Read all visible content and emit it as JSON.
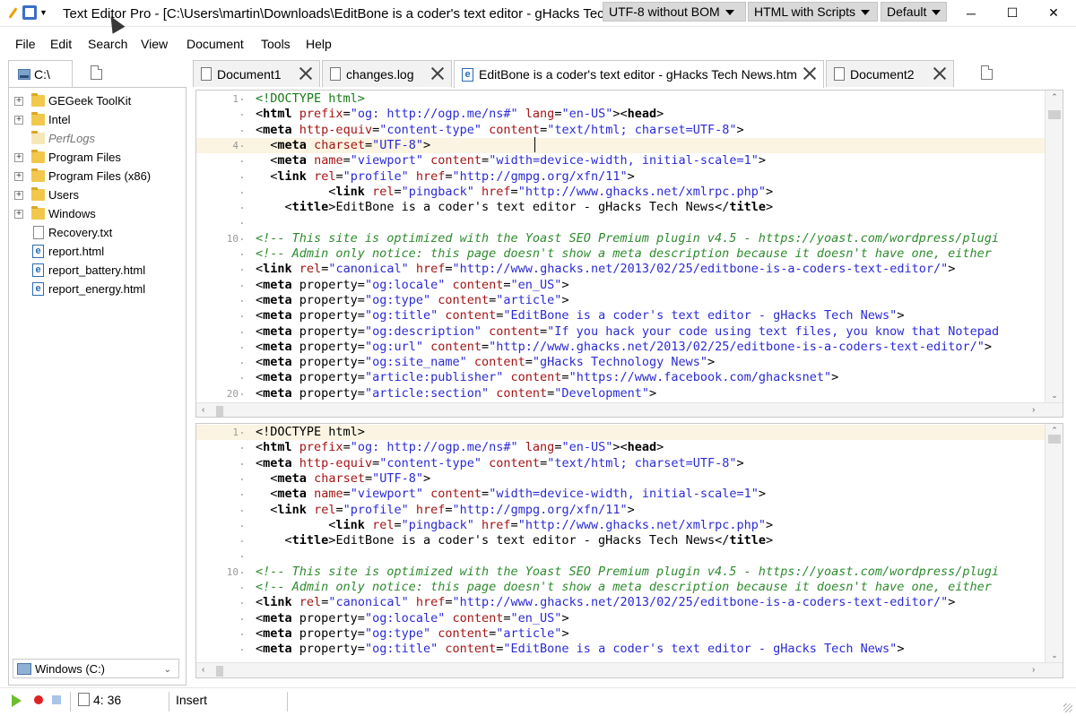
{
  "window": {
    "app_name": "Text Editor Pro",
    "title": "Text Editor Pro  -  [C:\\Users\\martin\\Downloads\\EditBone is a coder's text editor - gHacks Tech News.htm]",
    "encoding": "UTF-8 without BOM",
    "highlighter": "HTML with Scripts",
    "color_scheme": "Default",
    "minimize": "─",
    "maximize": "☐",
    "close": "✕"
  },
  "menu": [
    "File",
    "Edit",
    "Search",
    "View",
    "Document",
    "Tools",
    "Help"
  ],
  "file_panel": {
    "tab_label": "C:\\",
    "tree": [
      {
        "label": "GEGeek ToolKit",
        "type": "folder",
        "expandable": true
      },
      {
        "label": "Intel",
        "type": "folder",
        "expandable": true
      },
      {
        "label": "PerfLogs",
        "type": "folder-hidden",
        "expandable": false
      },
      {
        "label": "Program Files",
        "type": "folder",
        "expandable": true
      },
      {
        "label": "Program Files (x86)",
        "type": "folder",
        "expandable": true
      },
      {
        "label": "Users",
        "type": "folder",
        "expandable": true
      },
      {
        "label": "Windows",
        "type": "folder",
        "expandable": true
      },
      {
        "label": "Recovery.txt",
        "type": "txt",
        "expandable": false
      },
      {
        "label": "report.html",
        "type": "html",
        "expandable": false
      },
      {
        "label": "report_battery.html",
        "type": "html",
        "expandable": false
      },
      {
        "label": "report_energy.html",
        "type": "html",
        "expandable": false
      }
    ],
    "drive_select": "Windows (C:)"
  },
  "tabs": [
    {
      "label": "Document1",
      "active": false
    },
    {
      "label": "changes.log",
      "active": false
    },
    {
      "label": "EditBone is a coder's text editor - gHacks Tech News.htm",
      "active": true
    },
    {
      "label": "Document2",
      "active": false
    }
  ],
  "editor_top": {
    "current_line": 4,
    "lines": [
      {
        "n": "1",
        "html": "<span class='dt'>&lt;!DOCTYPE html&gt;</span>"
      },
      {
        "n": "",
        "html": "<span class='ang'>&lt;</span><span class='tag'>html</span> <span class='attr'>prefix</span>=<span class='val'>\"og: http://ogp.me/ns#\"</span> <span class='attr'>lang</span>=<span class='val'>\"en-US\"</span><span class='ang'>&gt;&lt;</span><span class='tag'>head</span><span class='ang'>&gt;</span>"
      },
      {
        "n": "",
        "html": "<span class='ang'>&lt;</span><span class='tag'>meta</span> <span class='attr'>http-equiv</span>=<span class='val'>\"content-type\"</span> <span class='attr'>content</span>=<span class='val'>\"text/html; charset=UTF-8\"</span><span class='ang'>&gt;</span>"
      },
      {
        "n": "4",
        "html": "  <span class='ang'>&lt;</span><span class='tag'>meta</span> <span class='attr'>charset</span>=<span class='val'>\"UTF-8\"</span><span class='ang'>&gt;</span>"
      },
      {
        "n": "",
        "html": "  <span class='ang'>&lt;</span><span class='tag'>meta</span> <span class='attr'>name</span>=<span class='val'>\"viewport\"</span> <span class='attr'>content</span>=<span class='val'>\"width=device-width, initial-scale=1\"</span><span class='ang'>&gt;</span>"
      },
      {
        "n": "",
        "html": "  <span class='ang'>&lt;</span><span class='tag'>link</span> <span class='attr'>rel</span>=<span class='val'>\"profile\"</span> <span class='attr'>href</span>=<span class='val'>\"http://gmpg.org/xfn/11\"</span><span class='ang'>&gt;</span>"
      },
      {
        "n": "",
        "html": "          <span class='ang'>&lt;</span><span class='tag'>link</span> <span class='attr'>rel</span>=<span class='val'>\"pingback\"</span> <span class='attr'>href</span>=<span class='val'>\"http://www.ghacks.net/xmlrpc.php\"</span><span class='ang'>&gt;</span>"
      },
      {
        "n": "",
        "html": "    <span class='ang'>&lt;</span><span class='tag'>title</span><span class='ang'>&gt;</span>EditBone is a coder's text editor - gHacks Tech News<span class='ang'>&lt;/</span><span class='tag'>title</span><span class='ang'>&gt;</span>"
      },
      {
        "n": "",
        "html": ""
      },
      {
        "n": "10",
        "html": "<span class='cm'>&lt;!-- This site is optimized with the Yoast SEO Premium plugin v4.5 - https://yoast.com/wordpress/plugi</span>"
      },
      {
        "n": "",
        "html": "<span class='cm'>&lt;!-- Admin only notice: this page doesn't show a meta description because it doesn't have one, either</span>"
      },
      {
        "n": "",
        "html": "<span class='ang'>&lt;</span><span class='tag'>link</span> <span class='attr'>rel</span>=<span class='val'>\"canonical\"</span> <span class='attr'>href</span>=<span class='val'>\"http://www.ghacks.net/2013/02/25/editbone-is-a-coders-text-editor/\"</span><span class='ang'>&gt;</span>"
      },
      {
        "n": "",
        "html": "<span class='ang'>&lt;</span><span class='tag'>meta</span> property=<span class='val'>\"og:locale\"</span> <span class='attr'>content</span>=<span class='val'>\"en_US\"</span><span class='ang'>&gt;</span>"
      },
      {
        "n": "",
        "html": "<span class='ang'>&lt;</span><span class='tag'>meta</span> property=<span class='val'>\"og:type\"</span> <span class='attr'>content</span>=<span class='val'>\"article\"</span><span class='ang'>&gt;</span>"
      },
      {
        "n": "",
        "html": "<span class='ang'>&lt;</span><span class='tag'>meta</span> property=<span class='val'>\"og:title\"</span> <span class='attr'>content</span>=<span class='val'>\"EditBone is a coder's text editor - gHacks Tech News\"</span><span class='ang'>&gt;</span>"
      },
      {
        "n": "",
        "html": "<span class='ang'>&lt;</span><span class='tag'>meta</span> property=<span class='val'>\"og:description\"</span> <span class='attr'>content</span>=<span class='val'>\"If you hack your code using text files, you know that Notepad</span>"
      },
      {
        "n": "",
        "html": "<span class='ang'>&lt;</span><span class='tag'>meta</span> property=<span class='val'>\"og:url\"</span> <span class='attr'>content</span>=<span class='val'>\"http://www.ghacks.net/2013/02/25/editbone-is-a-coders-text-editor/\"</span><span class='ang'>&gt;</span>"
      },
      {
        "n": "",
        "html": "<span class='ang'>&lt;</span><span class='tag'>meta</span> property=<span class='val'>\"og:site_name\"</span> <span class='attr'>content</span>=<span class='val'>\"gHacks Technology News\"</span><span class='ang'>&gt;</span>"
      },
      {
        "n": "",
        "html": "<span class='ang'>&lt;</span><span class='tag'>meta</span> property=<span class='val'>\"article:publisher\"</span> <span class='attr'>content</span>=<span class='val'>\"https://www.facebook.com/ghacksnet\"</span><span class='ang'>&gt;</span>"
      },
      {
        "n": "20",
        "html": "<span class='ang'>&lt;</span><span class='tag'>meta</span> property=<span class='val'>\"article:section\"</span> <span class='attr'>content</span>=<span class='val'>\"Development\"</span><span class='ang'>&gt;</span>"
      }
    ]
  },
  "editor_bottom": {
    "current_line": 1,
    "lines": [
      {
        "n": "1",
        "html": "<span class='ang'>&lt;!DOCTYPE html&gt;</span>"
      },
      {
        "n": "",
        "html": "<span class='ang'>&lt;</span><span class='tag'>html</span> <span class='attr'>prefix</span>=<span class='val'>\"og: http://ogp.me/ns#\"</span> <span class='attr'>lang</span>=<span class='val'>\"en-US\"</span><span class='ang'>&gt;&lt;</span><span class='tag'>head</span><span class='ang'>&gt;</span>"
      },
      {
        "n": "",
        "html": "<span class='ang'>&lt;</span><span class='tag'>meta</span> <span class='attr'>http-equiv</span>=<span class='val'>\"content-type\"</span> <span class='attr'>content</span>=<span class='val'>\"text/html; charset=UTF-8\"</span><span class='ang'>&gt;</span>"
      },
      {
        "n": "",
        "html": "  <span class='ang'>&lt;</span><span class='tag'>meta</span> <span class='attr'>charset</span>=<span class='val'>\"UTF-8\"</span><span class='ang'>&gt;</span>"
      },
      {
        "n": "",
        "html": "  <span class='ang'>&lt;</span><span class='tag'>meta</span> <span class='attr'>name</span>=<span class='val'>\"viewport\"</span> <span class='attr'>content</span>=<span class='val'>\"width=device-width, initial-scale=1\"</span><span class='ang'>&gt;</span>"
      },
      {
        "n": "",
        "html": "  <span class='ang'>&lt;</span><span class='tag'>link</span> <span class='attr'>rel</span>=<span class='val'>\"profile\"</span> <span class='attr'>href</span>=<span class='val'>\"http://gmpg.org/xfn/11\"</span><span class='ang'>&gt;</span>"
      },
      {
        "n": "",
        "html": "          <span class='ang'>&lt;</span><span class='tag'>link</span> <span class='attr'>rel</span>=<span class='val'>\"pingback\"</span> <span class='attr'>href</span>=<span class='val'>\"http://www.ghacks.net/xmlrpc.php\"</span><span class='ang'>&gt;</span>"
      },
      {
        "n": "",
        "html": "    <span class='ang'>&lt;</span><span class='tag'>title</span><span class='ang'>&gt;</span>EditBone is a coder's text editor - gHacks Tech News<span class='ang'>&lt;/</span><span class='tag'>title</span><span class='ang'>&gt;</span>"
      },
      {
        "n": "",
        "html": ""
      },
      {
        "n": "10",
        "html": "<span class='cm'>&lt;!-- This site is optimized with the Yoast SEO Premium plugin v4.5 - https://yoast.com/wordpress/plugi</span>"
      },
      {
        "n": "",
        "html": "<span class='cm'>&lt;!-- Admin only notice: this page doesn't show a meta description because it doesn't have one, either</span>"
      },
      {
        "n": "",
        "html": "<span class='ang'>&lt;</span><span class='tag'>link</span> <span class='attr'>rel</span>=<span class='val'>\"canonical\"</span> <span class='attr'>href</span>=<span class='val'>\"http://www.ghacks.net/2013/02/25/editbone-is-a-coders-text-editor/\"</span><span class='ang'>&gt;</span>"
      },
      {
        "n": "",
        "html": "<span class='ang'>&lt;</span><span class='tag'>meta</span> property=<span class='val'>\"og:locale\"</span> <span class='attr'>content</span>=<span class='val'>\"en_US\"</span><span class='ang'>&gt;</span>"
      },
      {
        "n": "",
        "html": "<span class='ang'>&lt;</span><span class='tag'>meta</span> property=<span class='val'>\"og:type\"</span> <span class='attr'>content</span>=<span class='val'>\"article\"</span><span class='ang'>&gt;</span>"
      },
      {
        "n": "",
        "html": "<span class='ang'>&lt;</span><span class='tag'>meta</span> property=<span class='val'>\"og:title\"</span> <span class='attr'>content</span>=<span class='val'>\"EditBone is a coder's text editor - gHacks Tech News\"</span><span class='ang'>&gt;</span>"
      }
    ]
  },
  "status": {
    "position": "4: 36",
    "mode": "Insert"
  },
  "colors": {
    "current_line_bg": "#fbf4e2",
    "tag": "#000000",
    "attribute": "#a31515",
    "value": "#2b2bd4",
    "comment": "#2e8b2e"
  }
}
